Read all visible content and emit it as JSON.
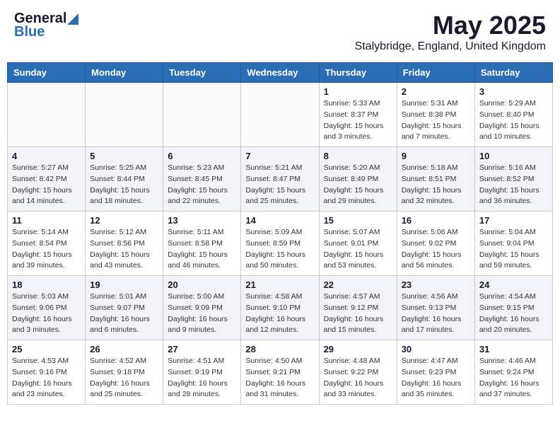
{
  "header": {
    "logo_general": "General",
    "logo_blue": "Blue",
    "month_title": "May 2025",
    "location": "Stalybridge, England, United Kingdom"
  },
  "weekdays": [
    "Sunday",
    "Monday",
    "Tuesday",
    "Wednesday",
    "Thursday",
    "Friday",
    "Saturday"
  ],
  "weeks": [
    [
      {
        "day": "",
        "info": ""
      },
      {
        "day": "",
        "info": ""
      },
      {
        "day": "",
        "info": ""
      },
      {
        "day": "",
        "info": ""
      },
      {
        "day": "1",
        "info": "Sunrise: 5:33 AM\nSunset: 8:37 PM\nDaylight: 15 hours\nand 3 minutes."
      },
      {
        "day": "2",
        "info": "Sunrise: 5:31 AM\nSunset: 8:38 PM\nDaylight: 15 hours\nand 7 minutes."
      },
      {
        "day": "3",
        "info": "Sunrise: 5:29 AM\nSunset: 8:40 PM\nDaylight: 15 hours\nand 10 minutes."
      }
    ],
    [
      {
        "day": "4",
        "info": "Sunrise: 5:27 AM\nSunset: 8:42 PM\nDaylight: 15 hours\nand 14 minutes."
      },
      {
        "day": "5",
        "info": "Sunrise: 5:25 AM\nSunset: 8:44 PM\nDaylight: 15 hours\nand 18 minutes."
      },
      {
        "day": "6",
        "info": "Sunrise: 5:23 AM\nSunset: 8:45 PM\nDaylight: 15 hours\nand 22 minutes."
      },
      {
        "day": "7",
        "info": "Sunrise: 5:21 AM\nSunset: 8:47 PM\nDaylight: 15 hours\nand 25 minutes."
      },
      {
        "day": "8",
        "info": "Sunrise: 5:20 AM\nSunset: 8:49 PM\nDaylight: 15 hours\nand 29 minutes."
      },
      {
        "day": "9",
        "info": "Sunrise: 5:18 AM\nSunset: 8:51 PM\nDaylight: 15 hours\nand 32 minutes."
      },
      {
        "day": "10",
        "info": "Sunrise: 5:16 AM\nSunset: 8:52 PM\nDaylight: 15 hours\nand 36 minutes."
      }
    ],
    [
      {
        "day": "11",
        "info": "Sunrise: 5:14 AM\nSunset: 8:54 PM\nDaylight: 15 hours\nand 39 minutes."
      },
      {
        "day": "12",
        "info": "Sunrise: 5:12 AM\nSunset: 8:56 PM\nDaylight: 15 hours\nand 43 minutes."
      },
      {
        "day": "13",
        "info": "Sunrise: 5:11 AM\nSunset: 8:58 PM\nDaylight: 15 hours\nand 46 minutes."
      },
      {
        "day": "14",
        "info": "Sunrise: 5:09 AM\nSunset: 8:59 PM\nDaylight: 15 hours\nand 50 minutes."
      },
      {
        "day": "15",
        "info": "Sunrise: 5:07 AM\nSunset: 9:01 PM\nDaylight: 15 hours\nand 53 minutes."
      },
      {
        "day": "16",
        "info": "Sunrise: 5:06 AM\nSunset: 9:02 PM\nDaylight: 15 hours\nand 56 minutes."
      },
      {
        "day": "17",
        "info": "Sunrise: 5:04 AM\nSunset: 9:04 PM\nDaylight: 15 hours\nand 59 minutes."
      }
    ],
    [
      {
        "day": "18",
        "info": "Sunrise: 5:03 AM\nSunset: 9:06 PM\nDaylight: 16 hours\nand 3 minutes."
      },
      {
        "day": "19",
        "info": "Sunrise: 5:01 AM\nSunset: 9:07 PM\nDaylight: 16 hours\nand 6 minutes."
      },
      {
        "day": "20",
        "info": "Sunrise: 5:00 AM\nSunset: 9:09 PM\nDaylight: 16 hours\nand 9 minutes."
      },
      {
        "day": "21",
        "info": "Sunrise: 4:58 AM\nSunset: 9:10 PM\nDaylight: 16 hours\nand 12 minutes."
      },
      {
        "day": "22",
        "info": "Sunrise: 4:57 AM\nSunset: 9:12 PM\nDaylight: 16 hours\nand 15 minutes."
      },
      {
        "day": "23",
        "info": "Sunrise: 4:56 AM\nSunset: 9:13 PM\nDaylight: 16 hours\nand 17 minutes."
      },
      {
        "day": "24",
        "info": "Sunrise: 4:54 AM\nSunset: 9:15 PM\nDaylight: 16 hours\nand 20 minutes."
      }
    ],
    [
      {
        "day": "25",
        "info": "Sunrise: 4:53 AM\nSunset: 9:16 PM\nDaylight: 16 hours\nand 23 minutes."
      },
      {
        "day": "26",
        "info": "Sunrise: 4:52 AM\nSunset: 9:18 PM\nDaylight: 16 hours\nand 25 minutes."
      },
      {
        "day": "27",
        "info": "Sunrise: 4:51 AM\nSunset: 9:19 PM\nDaylight: 16 hours\nand 28 minutes."
      },
      {
        "day": "28",
        "info": "Sunrise: 4:50 AM\nSunset: 9:21 PM\nDaylight: 16 hours\nand 31 minutes."
      },
      {
        "day": "29",
        "info": "Sunrise: 4:48 AM\nSunset: 9:22 PM\nDaylight: 16 hours\nand 33 minutes."
      },
      {
        "day": "30",
        "info": "Sunrise: 4:47 AM\nSunset: 9:23 PM\nDaylight: 16 hours\nand 35 minutes."
      },
      {
        "day": "31",
        "info": "Sunrise: 4:46 AM\nSunset: 9:24 PM\nDaylight: 16 hours\nand 37 minutes."
      }
    ]
  ]
}
